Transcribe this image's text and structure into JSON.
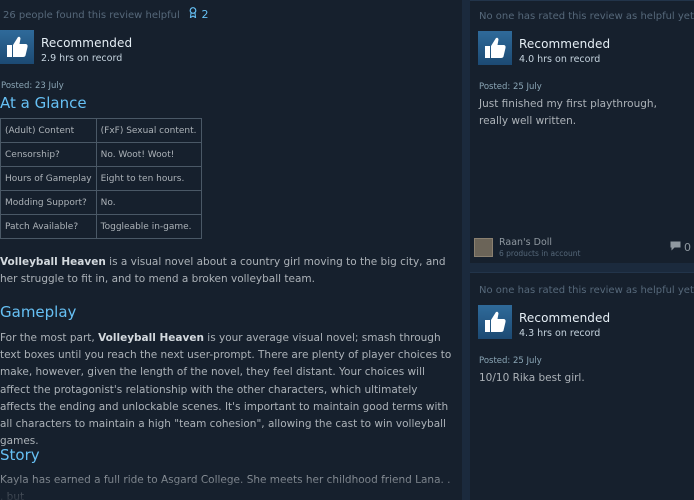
{
  "left_review": {
    "helpful_text": "26 people found this review helpful",
    "award_count": "2",
    "verdict": "Recommended",
    "hours": "2.9 hrs on record",
    "posted": "Posted: 23 July",
    "at_a_glance_heading": "At a Glance",
    "glance_table": [
      {
        "k": "(Adult) Content",
        "v": "(FxF) Sexual content."
      },
      {
        "k": "Censorship?",
        "v": "No. Woot! Woot!"
      },
      {
        "k": "Hours of Gameplay",
        "v": "Eight to ten hours."
      },
      {
        "k": "Modding Support?",
        "v": "No."
      },
      {
        "k": "Patch Available?",
        "v": "Toggleable in-game."
      }
    ],
    "intro_bold": "Volleyball Heaven",
    "intro_rest": " is a visual novel about a country girl moving to the big city, and her struggle to fit in, and to mend a broken volleyball team.",
    "gameplay_heading": "Gameplay",
    "gameplay_pre": "For the most part, ",
    "gameplay_bold": "Volleyball Heaven",
    "gameplay_rest": " is your average visual novel; smash through text boxes until you reach the next user-prompt. There are plenty of player choices to make, however, given the length of the novel, they feel distant. Your choices will affect the protagonist's relationship with the other characters, which ultimately affects the ending and unlockable scenes. It's important to maintain good terms with all characters to maintain a high \"team cohesion\", allowing the cast to win volleyball games.",
    "story_heading": "Story",
    "story_text": "Kayla has earned a full ride to Asgard College. She meets her childhood friend Lana. . . but"
  },
  "right_reviews": [
    {
      "helpful_text": "No one has rated this review as helpful yet",
      "award_count": "0",
      "verdict": "Recommended",
      "hours": "4.0 hrs on record",
      "posted": "Posted: 25 July",
      "text": "Just finished my first playthrough, really well written.",
      "author_name": "Raan's Doll",
      "author_sub": "6 products in account",
      "comment_count": "0"
    },
    {
      "helpful_text": "No one has rated this review as helpful yet",
      "award_count": "0",
      "verdict": "Recommended",
      "hours": "4.3 hrs on record",
      "posted": "Posted: 25 July",
      "text": "10/10 Rika best girl."
    }
  ],
  "icons": {
    "thumb": "thumbs-up-icon",
    "award": "award-ribbon-icon",
    "comment": "comment-bubble-icon"
  },
  "colors": {
    "accent": "#66c0f4",
    "page_bg": "#16202d",
    "card_bg": "#1b2838"
  }
}
